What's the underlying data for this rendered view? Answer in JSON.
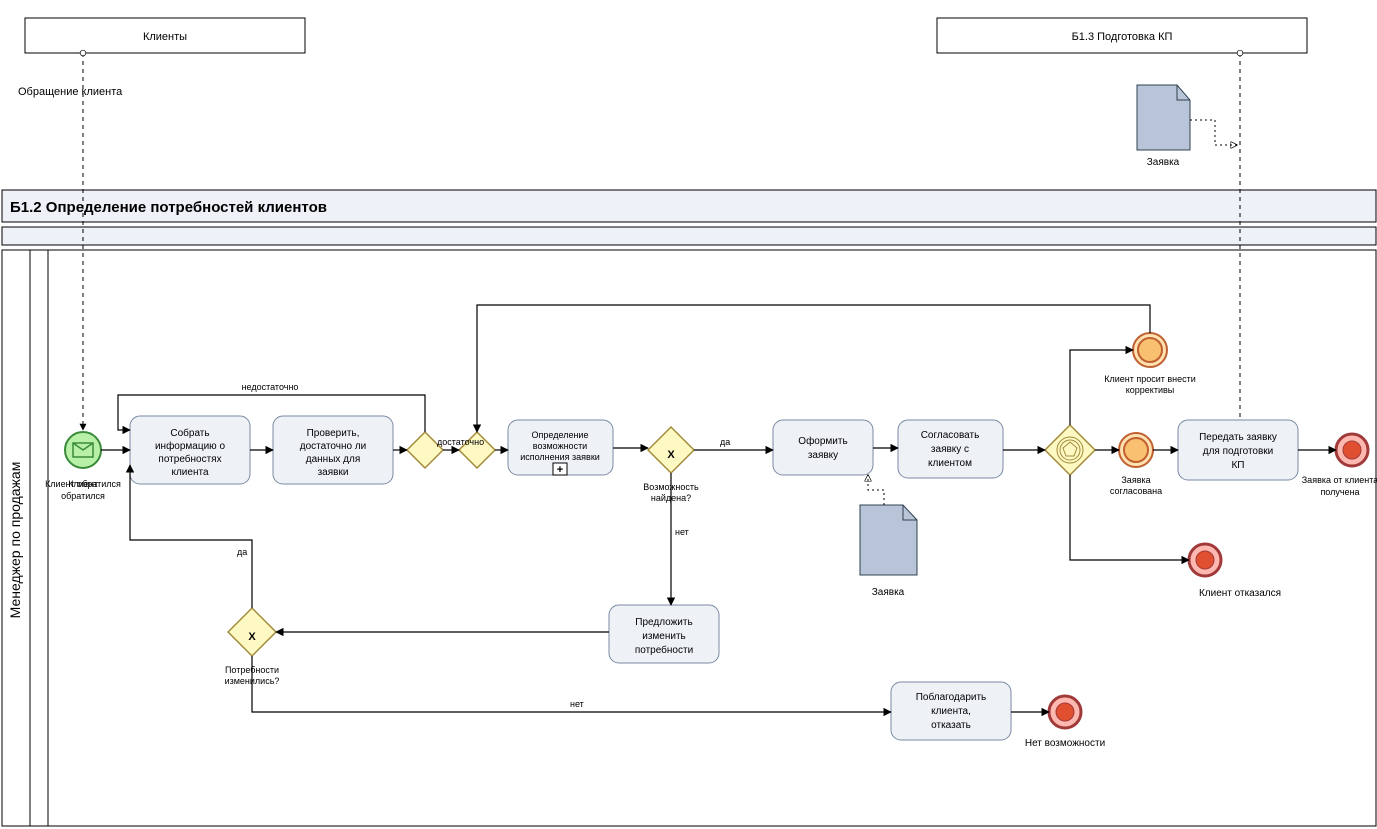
{
  "pools": {
    "clients": "Клиенты",
    "kp": "Б1.3 Подготовка КП",
    "main_title": "Б1.2 Определение потребностей клиентов",
    "lane": "Менеджер по продажам"
  },
  "msg": {
    "client_request": "Обращение клиента",
    "doc_top": "Заявка"
  },
  "events": {
    "start": "Клиент обратился",
    "int_corrections": "Клиент просит внести коррективы",
    "int_approved": "Заявка согласована",
    "end_refused": "Клиент отказался",
    "end_no_possibility": "Нет возможности",
    "end_received": "Заявка от клиента получена"
  },
  "tasks": {
    "collect": "Собрать информацию о потребностях клиента",
    "check": "Проверить, достаточно ли данных для заявки",
    "determine": "Определение возможности исполнения заявки",
    "form": "Оформить заявку",
    "agree": "Согласовать заявку с клиентом",
    "transfer": "Передать заявку для подготовки КП",
    "propose": "Предложить изменить потребности",
    "thank": "Поблагодарить клиента, отказать"
  },
  "gateways": {
    "g_check_label": "",
    "g_possibility": "Возможность найдена?",
    "g_changed": "Потребности изменились?"
  },
  "flow_labels": {
    "not_enough": "недостаточно",
    "enough": "достаточно",
    "yes": "да",
    "yes2": "да",
    "no": "нет",
    "no2": "нет"
  },
  "artifacts": {
    "doc_mid": "Заявка"
  }
}
